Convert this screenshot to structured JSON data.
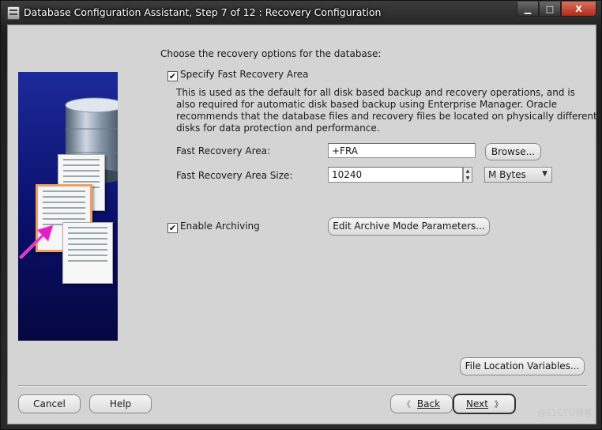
{
  "window": {
    "title": "Database Configuration Assistant, Step 7 of 12 : Recovery Configuration",
    "caption_buttons": {
      "minimize": "▁",
      "maximize": "□",
      "close": "X"
    }
  },
  "main": {
    "instruction": "Choose the recovery options for the database:",
    "specify_fra": {
      "label": "Specify Fast Recovery Area",
      "checked": true,
      "description": [
        "This is used as the default for all disk based backup and recovery operations, and is",
        "also required for automatic disk based backup using Enterprise Manager. Oracle",
        "recommends that the database files and recovery files be located on physically different",
        "disks for data protection and performance."
      ]
    },
    "fra_field": {
      "label": "Fast Recovery Area:",
      "value": "+FRA",
      "browse_label": "Browse..."
    },
    "fra_size": {
      "label": "Fast Recovery Area Size:",
      "value": "10240",
      "unit": "M Bytes"
    },
    "archiving": {
      "label": "Enable Archiving",
      "checked": true,
      "params_button": "Edit Archive Mode Parameters..."
    },
    "file_location_button": "File Location Variables..."
  },
  "footer": {
    "cancel": "Cancel",
    "help": "Help",
    "back": "Back",
    "next": "Next"
  },
  "watermark": "@51CTO博客",
  "icons": {
    "check": "✔",
    "spin_up": "▲",
    "spin_down": "▼",
    "dropdown": "▼",
    "back": "《",
    "next": "》"
  }
}
